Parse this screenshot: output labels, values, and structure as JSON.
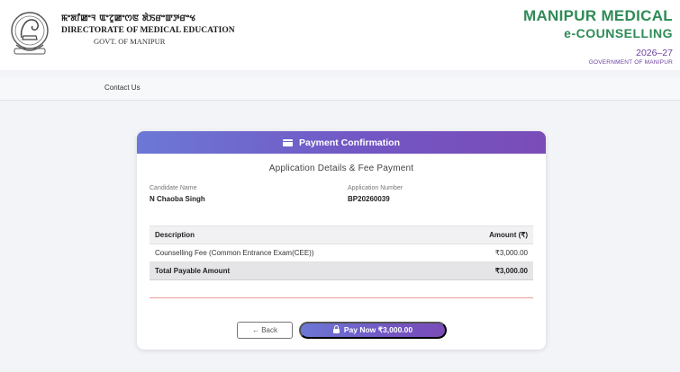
{
  "header": {
    "directorate_script": "ꯃꯦꯗꯤꯀꯦꯜ ꯑꯦꯖꯨꯀꯦꯁꯟ ꯗꯥꯏꯔꯦꯛꯇꯔꯦꯠ",
    "directorate_name": "DIRECTORATE OF MEDICAL EDUCATION",
    "directorate_govt": "GOVT. OF MANIPUR",
    "brand_line1": "MANIPUR MEDICAL",
    "brand_line2": "e-COUNSELLING",
    "brand_year": "2026–27",
    "brand_govt": "GOVERNMENT OF MANIPUR"
  },
  "nav": {
    "contact_label": "Contact Us"
  },
  "card": {
    "title": "Payment Confirmation",
    "subtitle": "Application Details & Fee Payment",
    "candidate_label": "Candidate Name",
    "candidate_value": "N Chaoba Singh",
    "application_label": "Application Number",
    "application_value": "BP20260039",
    "table": {
      "col_description": "Description",
      "col_amount": "Amount (₹)",
      "rows": [
        {
          "description": "Counselling Fee (Common Entrance Exam(CEE))",
          "amount": "₹3,000.00"
        }
      ],
      "total_label": "Total Payable Amount",
      "total_amount": "₹3,000.00"
    },
    "back_label": "← Back",
    "pay_label": "Pay Now ₹3,000.00"
  },
  "colors": {
    "brand_green": "#2e8b57",
    "accent_purple": "#7257c4",
    "divider_red": "#ef9b9b"
  }
}
